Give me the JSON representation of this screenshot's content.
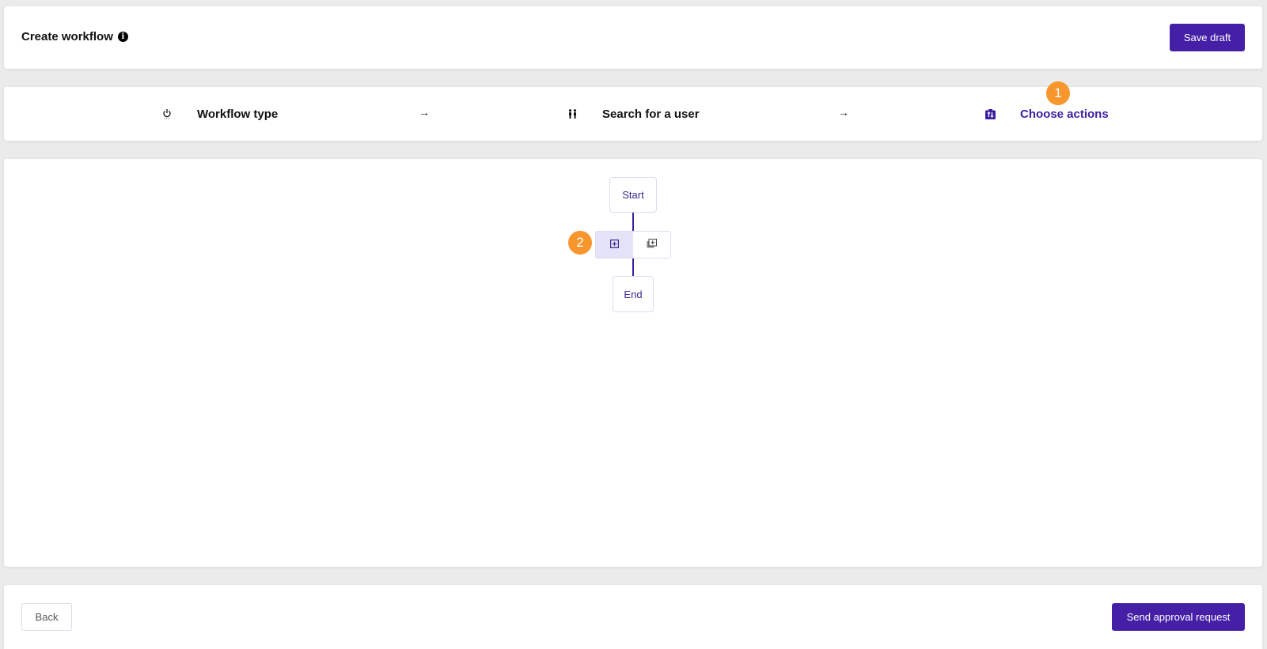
{
  "header": {
    "title": "Create workflow",
    "info_icon": "info-circle-icon",
    "save_draft_label": "Save draft"
  },
  "stepper": {
    "steps": [
      {
        "label": "Workflow type",
        "icon": "power-icon",
        "active": false
      },
      {
        "label": "Search for a user",
        "icon": "users-icon",
        "active": false
      },
      {
        "label": "Choose actions",
        "icon": "swap-actions-icon",
        "active": true
      }
    ],
    "separator_icon": "arrow-right-icon",
    "annotation_badge": "1"
  },
  "canvas": {
    "start_label": "Start",
    "end_label": "End",
    "actions": [
      {
        "icon": "add-square-icon",
        "selected": true
      },
      {
        "icon": "add-multiple-icon",
        "selected": false
      }
    ],
    "annotation_badge": "2"
  },
  "footer": {
    "back_label": "Back",
    "send_label": "Send approval request"
  },
  "colors": {
    "primary": "#4520a6",
    "active_text": "#3d1fa0",
    "badge": "#f7962c",
    "selected_action_bg": "#e4e3f8",
    "background": "#ebebeb"
  }
}
